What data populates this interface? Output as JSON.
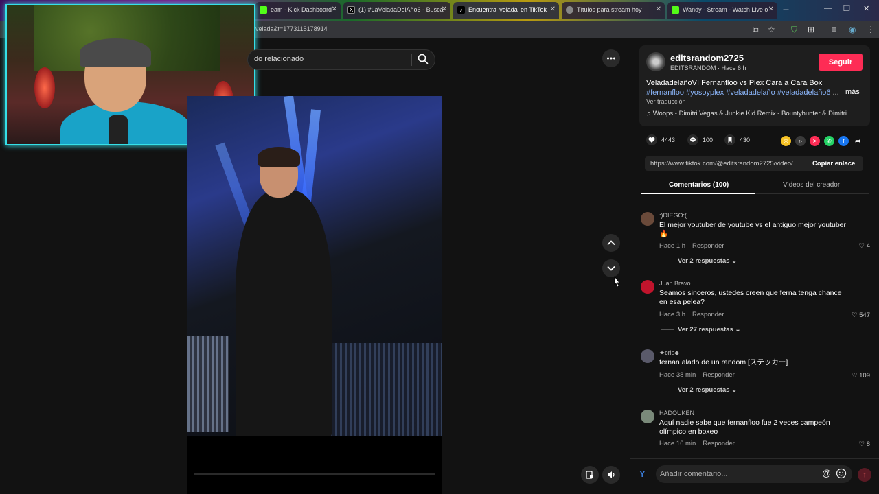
{
  "browser": {
    "tabs": [
      {
        "label": "eam - Kick Dashboard",
        "color": "#53fc18"
      },
      {
        "label": "(1) #LaVeladaDelAño6 - Busca",
        "color": "#000000"
      },
      {
        "label": "Encuentra 'velada' en TikTok",
        "color": "#000000"
      },
      {
        "label": "Títulos para stream hoy",
        "color": "#888888"
      },
      {
        "label": "Wandy - Stream - Watch Live o",
        "color": "#53fc18"
      }
    ],
    "url": "velada&t=1773115178914"
  },
  "search": {
    "text": "do relacionado"
  },
  "creator": {
    "username": "editsrandom2725",
    "subline": "EDITSRANDOM · Hace 6 h",
    "follow_label": "Seguir"
  },
  "description": {
    "text": "VeladadelañoVI Fernanfloo vs Plex Cara a Cara Box ",
    "tags": [
      "#fernanfloo",
      "#yosoyplex",
      "#veladadelaño",
      "#veladadelaño6"
    ],
    "ellipsis": " ...",
    "more": "más",
    "translate": "Ver traducción",
    "music": "♫  Woops - Dimitri Vegas & Junkie Kid Remix - Bountyhunter & Dimitri..."
  },
  "stats": {
    "likes": "4443",
    "comments": "100",
    "saves": "430"
  },
  "share_colors": [
    "#f7c325",
    "#3a3a3a",
    "#fe2c55",
    "#25d366",
    "#1877f2"
  ],
  "link": {
    "url": "https://www.tiktok.com/@editsrandom2725/video/...",
    "copy_label": "Copiar enlace"
  },
  "tabs": {
    "comments": "Comentarios (100)",
    "videos": "Videos del creador"
  },
  "comments": [
    {
      "user": ":)DIEGO:(",
      "text": "El mejor youtuber de youtube vs el antiguo mejor youtuber 🔥",
      "time": "Hace 1 h",
      "reply": "Responder",
      "likes": "4",
      "replies": "Ver 2 respuestas ⌄",
      "avatar_color": "#6a4a3a"
    },
    {
      "user": "Juan Bravo",
      "text": "Seamos sinceros, ustedes creen que ferna tenga chance en esa pelea?",
      "time": "Hace 3 h",
      "reply": "Responder",
      "likes": "547",
      "replies": "Ver 27 respuestas ⌄",
      "avatar_color": "#c0142c"
    },
    {
      "user": "★cris◆",
      "text": "fernan alado de un random [ステッカー]",
      "time": "Hace 38 min",
      "reply": "Responder",
      "likes": "109",
      "replies": "Ver 2 respuestas ⌄",
      "avatar_color": "#5a5a6a"
    },
    {
      "user": "HADOUKEN",
      "text": "Aquí nadie sabe que fernanfloo fue 2 veces campeón olímpico en boxeo",
      "time": "Hace 16 min",
      "reply": "Responder",
      "likes": "8",
      "replies": "",
      "avatar_color": "#7a8a7a"
    }
  ],
  "comment_box": {
    "placeholder": "Añadir comentario..."
  }
}
